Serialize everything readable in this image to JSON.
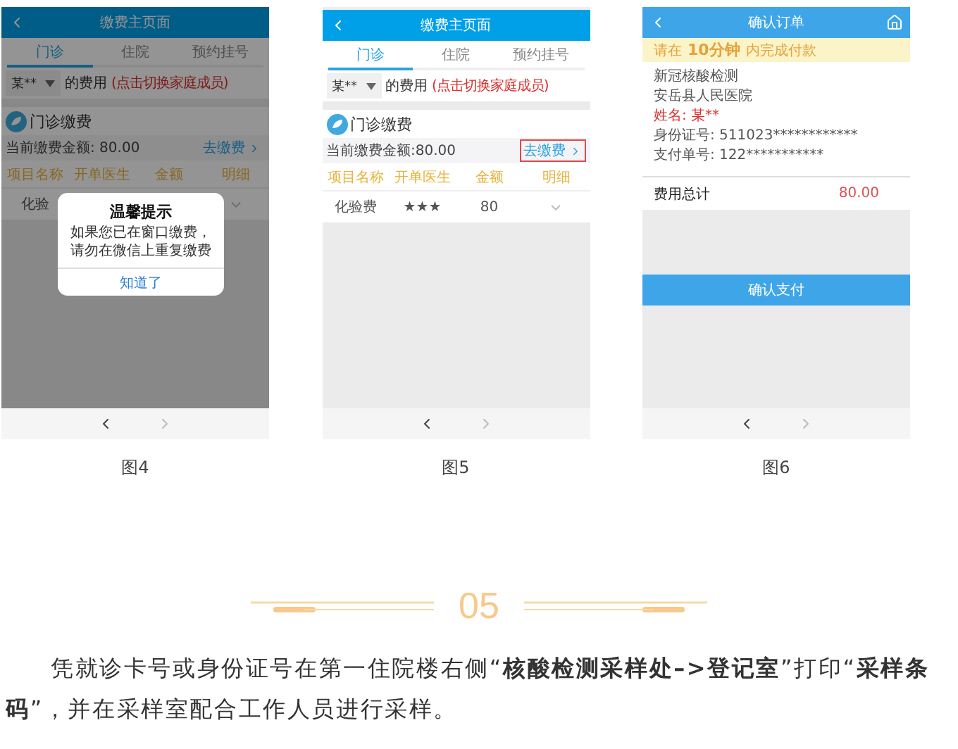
{
  "figures": [
    {
      "kind": "payment",
      "caption": "图4",
      "screen": {
        "title": "缴费主页面",
        "tabs": [
          {
            "label": "门诊",
            "selected": true
          },
          {
            "label": "住院",
            "selected": false
          },
          {
            "label": "预约挂号",
            "selected": false
          }
        ],
        "member": {
          "name": "某**",
          "suffix": "的费用",
          "hint": "(点击切换家庭成员)"
        },
        "section_title": "门诊缴费",
        "amount": "当前缴费金额: 80.00",
        "pay_link": {
          "label": "去缴费",
          "highlighted": false
        },
        "columns": [
          "项目名称",
          "开单医生",
          "金额",
          "明细"
        ],
        "rows": [
          {
            "cells": [
              "化验"
            ]
          }
        ],
        "dialog": {
          "title": "温馨提示",
          "message": "如果您已在窗口缴费，请勿在微信上重复缴费",
          "button": "知道了"
        }
      }
    },
    {
      "kind": "payment",
      "caption": "图5",
      "screen": {
        "title": "缴费主页面",
        "tabs": [
          {
            "label": "门诊",
            "selected": true
          },
          {
            "label": "住院",
            "selected": false
          },
          {
            "label": "预约挂号",
            "selected": false
          }
        ],
        "member": {
          "name": "某**",
          "suffix": "的费用",
          "hint": "(点击切换家庭成员)"
        },
        "section_title": "门诊缴费",
        "amount": "当前缴费金额:80.00",
        "pay_link": {
          "label": "去缴费",
          "highlighted": true
        },
        "columns": [
          "项目名称",
          "开单医生",
          "金额",
          "明细"
        ],
        "rows": [
          {
            "cells": [
              "化验费",
              "★★★",
              "80"
            ]
          }
        ]
      }
    },
    {
      "kind": "order",
      "caption": "图6",
      "screen": {
        "title": "确认订单",
        "banner": {
          "prefix": "请在",
          "highlight": "10分钟",
          "suffix": "内完成付款"
        },
        "lines": [
          {
            "text": "新冠核酸检测",
            "kind": "plain"
          },
          {
            "text": "安岳县人民医院",
            "kind": "plain"
          },
          {
            "text": "姓名: 某**",
            "kind": "alert"
          },
          {
            "text": "身份证号: 511023************",
            "kind": "plain"
          },
          {
            "text": "支付单号: 122***********",
            "kind": "plain"
          }
        ],
        "total_label": "费用总计",
        "total": "80.00",
        "button": "确认支付"
      }
    }
  ],
  "section": {
    "number": "05"
  },
  "paragraph": "凭就诊卡号或身份证号在第一住院楼右侧“**核酸检测采样处–>登记室**”打印“**采样条码**”，并在采样室配合工作人员进行采样。"
}
